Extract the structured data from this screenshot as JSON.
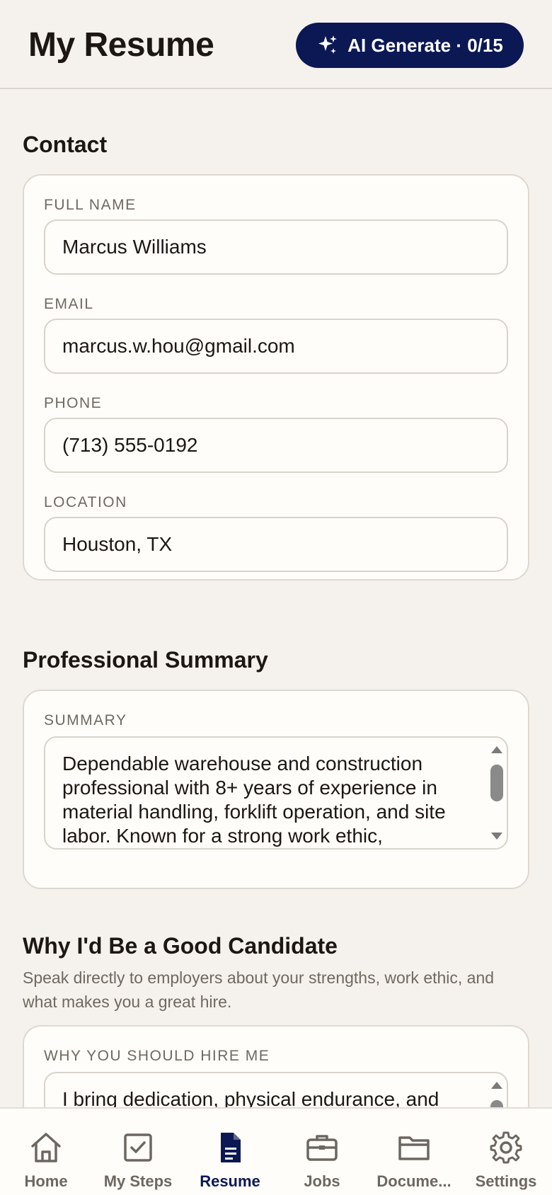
{
  "header": {
    "title": "My Resume",
    "ai_button_label": "AI Generate · 0/15"
  },
  "contact": {
    "section_title": "Contact",
    "full_name_label": "FULL NAME",
    "full_name_value": "Marcus Williams",
    "email_label": "EMAIL",
    "email_value": "marcus.w.hou@gmail.com",
    "phone_label": "PHONE",
    "phone_value": "(713) 555-0192",
    "location_label": "LOCATION",
    "location_value": "Houston, TX"
  },
  "summary": {
    "section_title": "Professional Summary",
    "field_label": "SUMMARY",
    "value": "Dependable warehouse and construction professional with 8+ years of experience in material handling, forklift operation, and site labor. Known for a strong work ethic,"
  },
  "candidate": {
    "section_title": "Why I'd Be a Good Candidate",
    "description": "Speak directly to employers about your strengths, work ethic, and what makes you a great hire.",
    "field_label": "WHY YOU SHOULD HIRE ME",
    "value": "I bring dedication, physical endurance, and"
  },
  "nav": {
    "items": [
      {
        "label": "Home",
        "icon": "home-icon"
      },
      {
        "label": "My Steps",
        "icon": "checkbox-icon"
      },
      {
        "label": "Resume",
        "icon": "document-icon"
      },
      {
        "label": "Jobs",
        "icon": "briefcase-icon"
      },
      {
        "label": "Docume...",
        "icon": "folder-icon"
      },
      {
        "label": "Settings",
        "icon": "gear-icon"
      }
    ],
    "active_index": 2
  },
  "colors": {
    "background": "#f5f1ec",
    "primary": "#0b1854",
    "card": "#fffdfa",
    "muted_text": "#6f6961"
  }
}
